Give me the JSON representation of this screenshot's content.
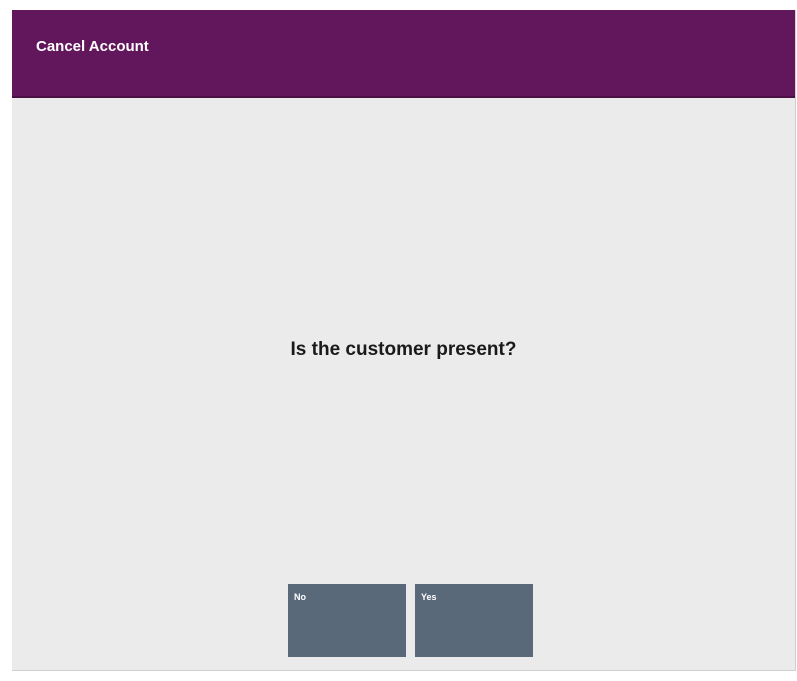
{
  "header": {
    "title": "Cancel Account"
  },
  "main": {
    "prompt": "Is the customer present?"
  },
  "buttons": {
    "no_label": "No",
    "yes_label": "Yes"
  },
  "colors": {
    "title_bar": "#62165c",
    "background": "#ebebeb",
    "button": "#59697a"
  }
}
